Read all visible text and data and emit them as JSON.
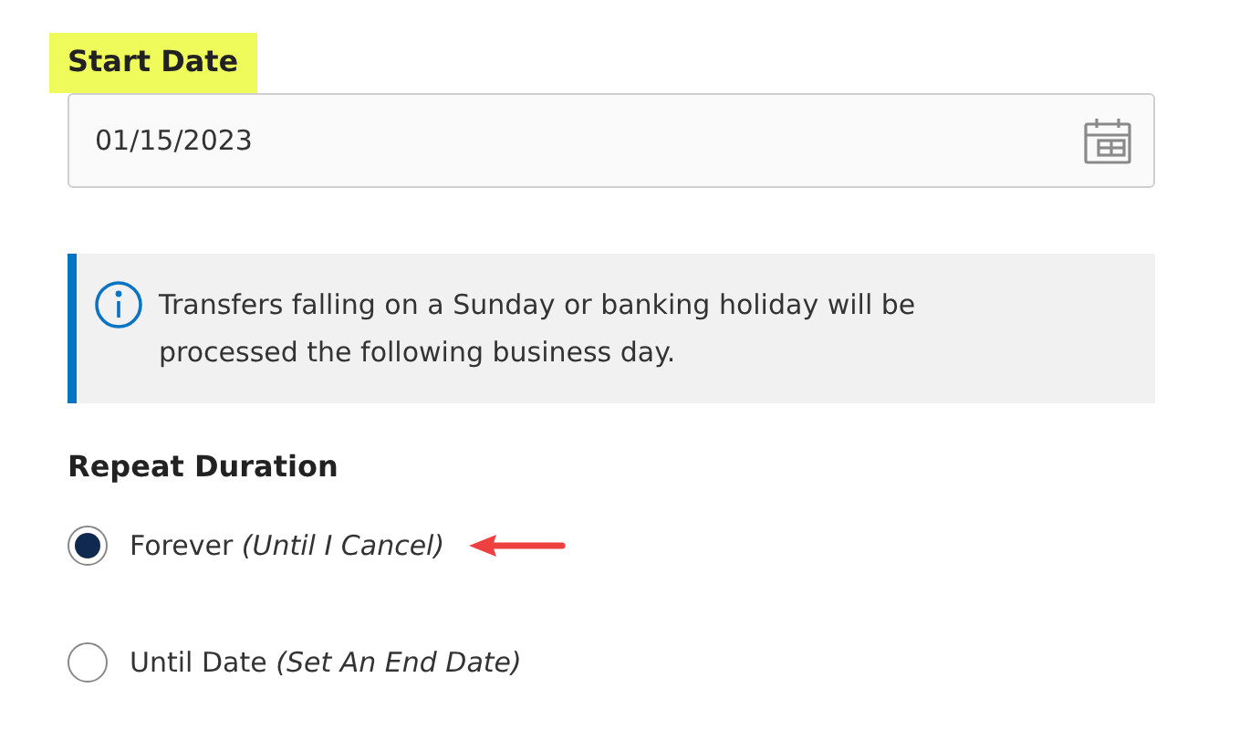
{
  "start_date": {
    "label": "Start Date",
    "label_highlighted": true,
    "value": "01/15/2023"
  },
  "notice": {
    "text": "Transfers falling on a Sunday or banking holiday will be processed the following business day."
  },
  "repeat_duration": {
    "label": "Repeat Duration",
    "options": [
      {
        "label": "Forever *(Until I Cancel)*",
        "selected": true,
        "arrow_pointer": true
      },
      {
        "label": "Until Date *(Set An End Date)*",
        "selected": false,
        "arrow_pointer": false
      }
    ]
  }
}
